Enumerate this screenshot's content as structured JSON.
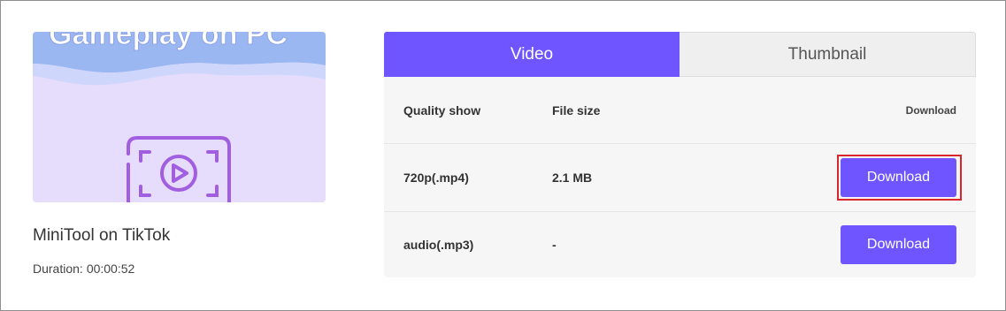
{
  "thumbnail": {
    "overlay_text": "Gameplay on PC",
    "icon": "play-screen-icon"
  },
  "video": {
    "title": "MiniTool on TikTok",
    "duration_label": "Duration:",
    "duration_value": "00:00:52"
  },
  "tabs": [
    {
      "label": "Video",
      "active": true
    },
    {
      "label": "Thumbnail",
      "active": false
    }
  ],
  "table": {
    "headers": {
      "quality": "Quality show",
      "size": "File size",
      "download": "Download"
    },
    "rows": [
      {
        "quality": "720p(.mp4)",
        "size": "2.1 MB",
        "action": "Download",
        "highlighted": true
      },
      {
        "quality": "audio(.mp3)",
        "size": "-",
        "action": "Download",
        "highlighted": false
      }
    ]
  },
  "colors": {
    "accent": "#6e55ff",
    "highlight_border": "#d9262e",
    "thumb_sky": "#9bb7f2",
    "thumb_bg": "#e6dcfb",
    "icon_purple": "#a25ee0"
  }
}
